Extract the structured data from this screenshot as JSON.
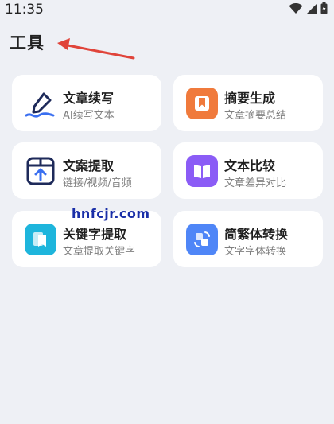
{
  "status": {
    "time": "11:35"
  },
  "header": {
    "title": "工具"
  },
  "tools": [
    {
      "title": "文章续写",
      "subtitle": "AI续写文本",
      "icon": "pen-icon"
    },
    {
      "title": "摘要生成",
      "subtitle": "文章摘要总结",
      "icon": "bookmark-icon",
      "color": "#f07a3c"
    },
    {
      "title": "文案提取",
      "subtitle": "链接/视频/音频",
      "icon": "upload-box-icon"
    },
    {
      "title": "文本比较",
      "subtitle": "文章差异对比",
      "icon": "book-icon",
      "color": "#8b5cf6"
    },
    {
      "title": "关键字提取",
      "subtitle": "文章提取关键字",
      "icon": "key-doc-icon",
      "color": "#1eb5dc"
    },
    {
      "title": "简繁体转换",
      "subtitle": "文字字体转换",
      "icon": "convert-icon",
      "color": "#4f86f7"
    }
  ],
  "watermark": "hnfcjr.com"
}
